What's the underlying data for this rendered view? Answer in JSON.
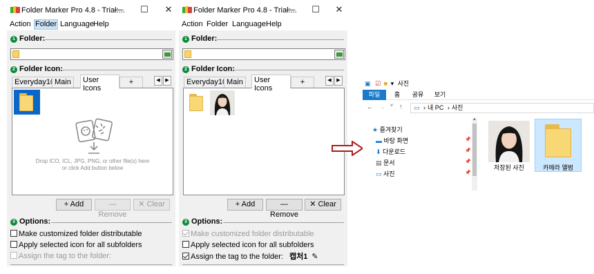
{
  "windows": [
    {
      "title": "Folder Marker Pro 4.8 - Trial:...",
      "menu": [
        "Action",
        "Folder",
        "Language",
        "Help"
      ],
      "highlighted_menu": "Folder",
      "section_folder": "Folder:",
      "section_icon": "Folder Icon:",
      "tabs": [
        "Everyday10",
        "Main",
        "User Icons",
        "+"
      ],
      "selected_tab": "User Icons",
      "drop_text_1": "Drop ICO, ICL, JPG, PNG, or other file(s) here",
      "drop_text_2": "or click Add button below",
      "buttons": {
        "add": "Add",
        "remove": "Remove",
        "clear": "Clear"
      },
      "section_options": "Options:",
      "options": [
        {
          "label": "Make customized folder distributable",
          "checked": false,
          "disabled": false
        },
        {
          "label": "Apply selected icon for all subfolders",
          "checked": false,
          "disabled": false
        },
        {
          "label": "Assign the tag to the folder:",
          "checked": false,
          "disabled": true
        }
      ],
      "tag_value": ""
    },
    {
      "title": "Folder Marker Pro 4.8 - Trial:...",
      "menu": [
        "Action",
        "Folder",
        "Language",
        "Help"
      ],
      "highlighted_menu": "",
      "section_folder": "Folder:",
      "section_icon": "Folder Icon:",
      "tabs": [
        "Everyday10",
        "Main",
        "User Icons",
        "+"
      ],
      "selected_tab": "User Icons",
      "buttons": {
        "add": "Add",
        "remove": "Remove",
        "clear": "Clear"
      },
      "section_options": "Options:",
      "options": [
        {
          "label": "Make customized folder distributable",
          "checked": true,
          "disabled": true
        },
        {
          "label": "Apply selected icon for all subfolders",
          "checked": false,
          "disabled": false
        },
        {
          "label": "Assign the tag to the folder:",
          "checked": true,
          "disabled": false
        }
      ],
      "tag_value": "캡처1"
    }
  ],
  "explorer": {
    "title": "사진",
    "ribbon_tabs": [
      "파일",
      "홈",
      "공유",
      "보기"
    ],
    "path": [
      "내 PC",
      "사진"
    ],
    "nav": [
      {
        "label": "즐겨찾기",
        "icon": "star-icon"
      },
      {
        "label": "바탕 화면",
        "icon": "desktop-icon"
      },
      {
        "label": "다운로드",
        "icon": "download-icon"
      },
      {
        "label": "문서",
        "icon": "document-icon"
      },
      {
        "label": "사진",
        "icon": "pictures-icon"
      }
    ],
    "files": [
      {
        "name": "저장된 사진",
        "type": "photo-folder"
      },
      {
        "name": "카메라 앨범",
        "type": "folder"
      }
    ]
  },
  "colors": {
    "accent": "#0a67c8",
    "section_green": "#0a8a3a",
    "folder_yellow": "#f8d775",
    "arrow_red": "#b01818",
    "ribbon_blue": "#1979ca"
  }
}
